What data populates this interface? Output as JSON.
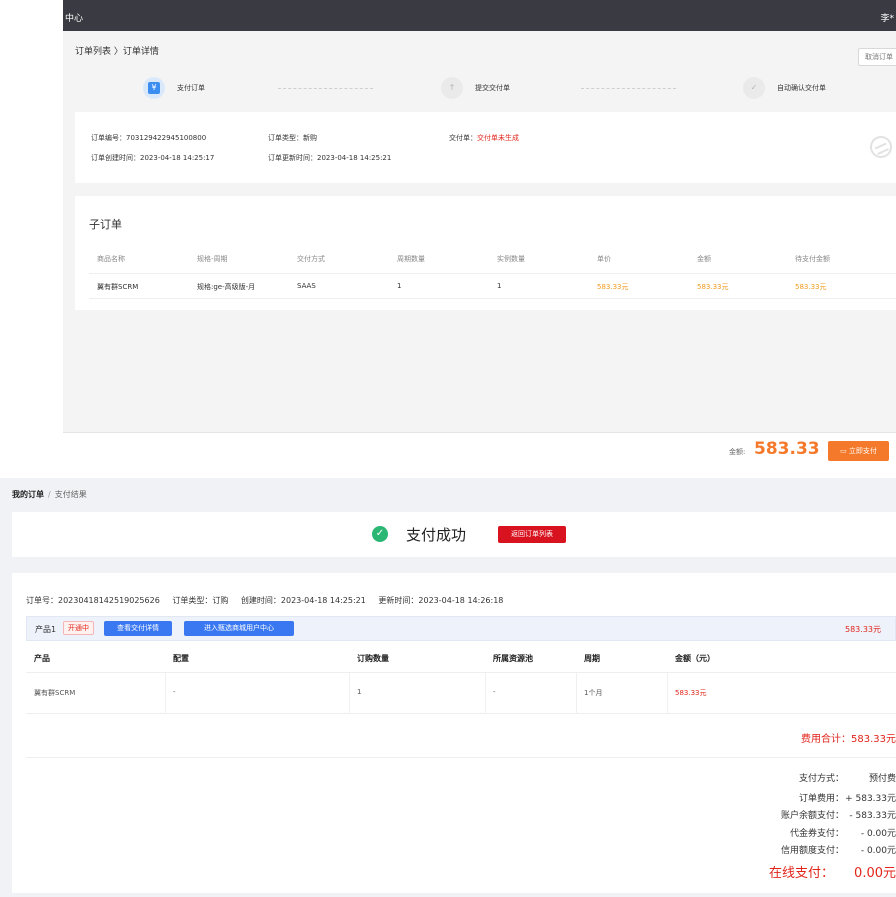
{
  "top": {
    "header": {
      "title": "中心",
      "user": "李*"
    },
    "breadcrumb": "订单列表 〉订单详情",
    "cancel_button": "取消订单",
    "steps": [
      {
        "label": "支付订单",
        "icon": "yen-icon"
      },
      {
        "label": "提交交付单",
        "icon": "upload-icon"
      },
      {
        "label": "自动确认交付单",
        "icon": "check-icon"
      }
    ],
    "info": {
      "order_no": "订单编号：703129422945100800",
      "order_type": "订单类型：新购",
      "delivery_label": "交付单：",
      "delivery_value": "交付单未生成",
      "created": "订单创建时间：2023-04-18 14:25:17",
      "updated": "订单更新时间：2023-04-18 14:25:21"
    },
    "sub_orders": {
      "title": "子订单",
      "columns": [
        "商品名称",
        "规格-周期",
        "交付方式",
        "周期数量",
        "实例数量",
        "单价",
        "金额",
        "待支付金额"
      ],
      "rows": [
        [
          "翼有群SCRM",
          "规格:ge-高级版-月",
          "SAAS",
          "1",
          "1",
          "583.33元",
          "583.33元",
          "583.33元"
        ]
      ]
    },
    "footer": {
      "amount_label": "金额:",
      "amount_value": "583.33",
      "pay_button": "立即支付",
      "pay_icon": "card-icon"
    }
  },
  "bottom": {
    "breadcrumb": {
      "root": "我的订单",
      "sep": "/",
      "current": "支付结果"
    },
    "success": {
      "text": "支付成功",
      "back_button": "返回订单列表",
      "icon": "check-circle-icon"
    },
    "order_meta": {
      "order_no": "订单号：20230418142519025626",
      "order_type": "订单类型：订购",
      "created": "创建时间：2023-04-18 14:25:21",
      "updated": "更新时间：2023-04-18 14:26:18"
    },
    "product_bar": {
      "label": "产品1",
      "status": "开通中",
      "detail_button": "查看交付详情",
      "mall_button": "进入甄选商城用户中心",
      "price": "583.33元"
    },
    "table": {
      "columns": [
        "产品",
        "配置",
        "订购数量",
        "所属资源池",
        "周期",
        "金额（元）"
      ],
      "rows": [
        [
          "翼有群SCRM",
          "-",
          "1",
          "-",
          "1个月",
          "583.33元"
        ]
      ]
    },
    "fee_total": "费用合计：583.33元",
    "summary": [
      {
        "label": "支付方式：",
        "value": "预付费"
      },
      {
        "label": "订单费用：",
        "value": "+ 583.33元"
      },
      {
        "label": "账户余额支付：",
        "value": "- 583.33元"
      },
      {
        "label": "代金券支付：",
        "value": "- 0.00元"
      },
      {
        "label": "信用额度支付：",
        "value": "- 0.00元"
      }
    ],
    "online_pay": {
      "label": "在线支付：",
      "value": "0.00元"
    }
  },
  "colors": {
    "accent_orange": "#f5792a",
    "price_orange": "#f29b1e",
    "danger_red": "#e1251b",
    "primary_blue": "#3a78f2",
    "success_green": "#2bb673",
    "header_dark": "#3a3b42"
  }
}
